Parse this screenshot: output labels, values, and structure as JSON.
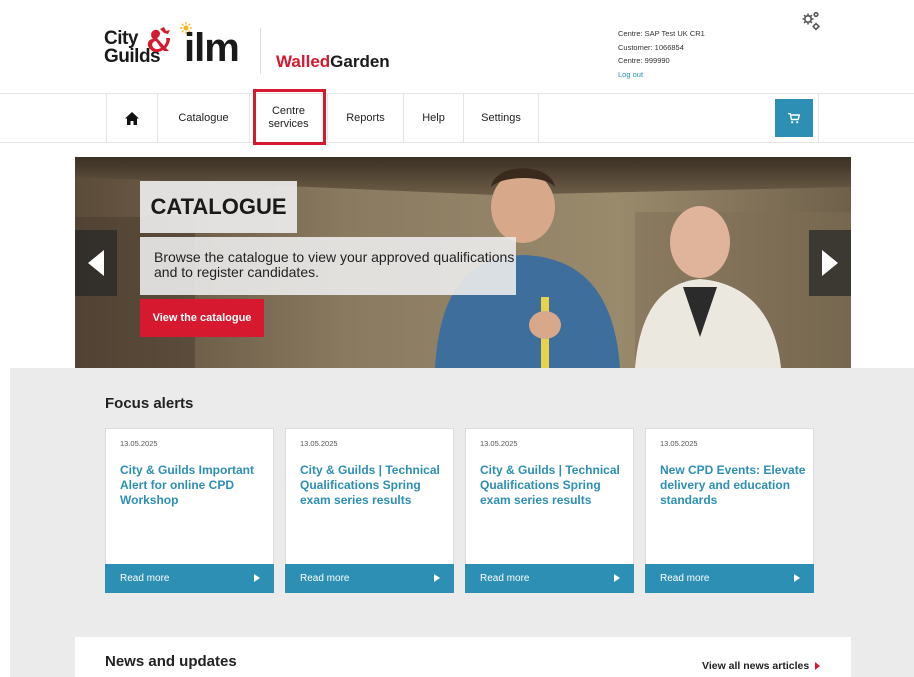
{
  "header": {
    "brand_cg_line1": "City",
    "brand_cg_line2": "Guilds",
    "brand_ilm": "ilm",
    "walled_part1": "Walled",
    "walled_part2": "Garden",
    "account": {
      "centre_name": "Centre:  SAP Test UK CR1",
      "customer": "Customer:  1066854",
      "centre_number": "Centre:  999990",
      "logout": "Log out"
    },
    "settings_icon": "gears-icon"
  },
  "nav": {
    "home_icon": "home-icon",
    "catalogue": "Catalogue",
    "centre_services": "Centre services",
    "reports": "Reports",
    "help": "Help",
    "settings": "Settings",
    "cart_icon": "cart-icon"
  },
  "hero": {
    "title": "CATALOGUE",
    "description": "Browse the catalogue to view your approved qualifications and to register candidates.",
    "button": "View the catalogue",
    "prev_icon": "arrow-left-icon",
    "next_icon": "arrow-right-icon"
  },
  "focus": {
    "title": "Focus alerts",
    "cards": [
      {
        "date": "13.05.2025",
        "title": "City & Guilds Important Alert for online CPD Workshop",
        "read_more": "Read more"
      },
      {
        "date": "13.05.2025",
        "title": "City & Guilds | Technical Qualifications Spring exam series results",
        "read_more": "Read more"
      },
      {
        "date": "13.05.2025",
        "title": "City & Guilds | Technical Qualifications Spring exam series results",
        "read_more": "Read more"
      },
      {
        "date": "13.05.2025",
        "title": "New CPD Events: Elevate delivery and education standards",
        "read_more": "Read more"
      }
    ]
  },
  "news": {
    "title": "News and updates",
    "view_all": "View all news articles"
  },
  "colors": {
    "brand_red": "#d7192f",
    "accent_blue": "#2d8fb3",
    "section_grey": "#ebebeb"
  }
}
